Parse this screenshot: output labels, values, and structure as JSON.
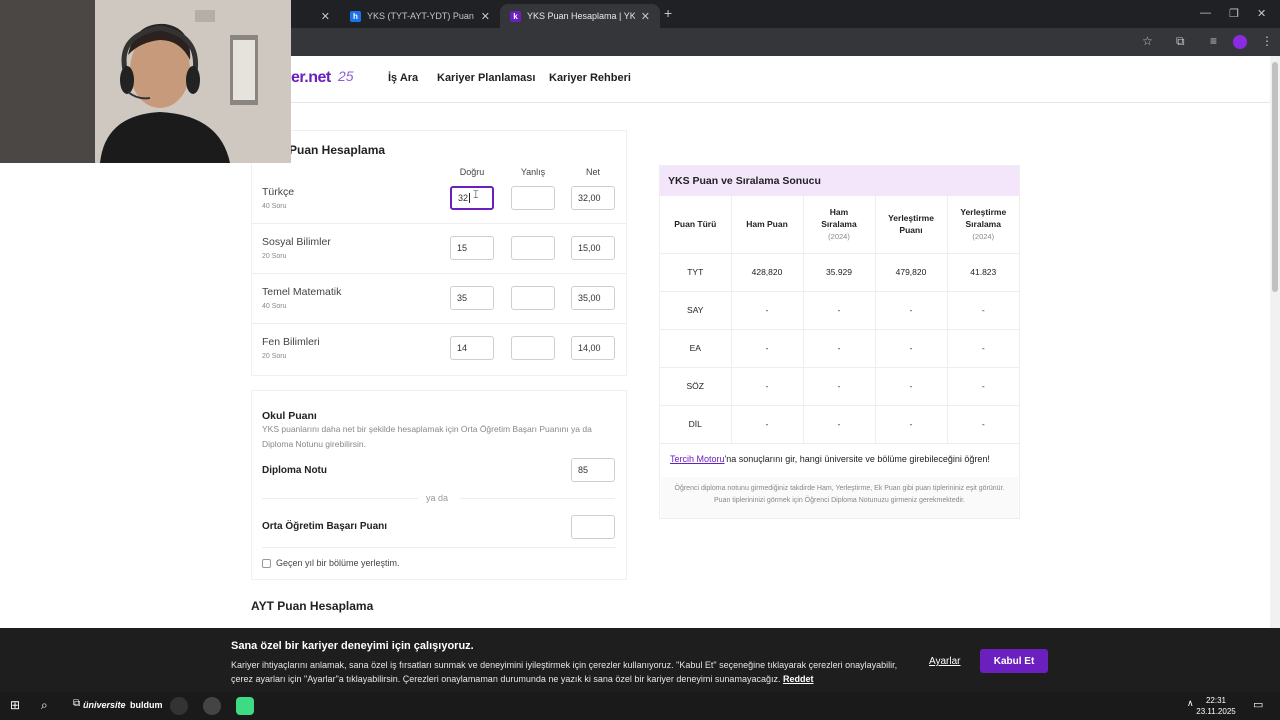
{
  "browser": {
    "tabs": [
      {
        "title": "",
        "active": false
      },
      {
        "title": "YKS (TYT-AYT-YDT) Puan Hesap",
        "active": false
      },
      {
        "title": "YKS Puan Hesaplama | YKS (TY",
        "active": true
      }
    ],
    "new_tab": "+"
  },
  "site": {
    "logo": "er.net",
    "logo_badge": "25",
    "nav": [
      "İş Ara",
      "Kariyer Planlaması",
      "Kariyer Rehberi"
    ]
  },
  "tyt": {
    "title": "Puan Hesaplama",
    "columns": {
      "dogru": "Doğru",
      "yanlis": "Yanlış",
      "net": "Net"
    },
    "rows": [
      {
        "subject": "Türkçe",
        "questions": "40 Soru",
        "dogru": "32",
        "yanlis": "",
        "net": "32,00"
      },
      {
        "subject": "Sosyal Bilimler",
        "questions": "20 Soru",
        "dogru": "15",
        "yanlis": "",
        "net": "15,00"
      },
      {
        "subject": "Temel Matematik",
        "questions": "40 Soru",
        "dogru": "35",
        "yanlis": "",
        "net": "35,00"
      },
      {
        "subject": "Fen Bilimleri",
        "questions": "20 Soru",
        "dogru": "14",
        "yanlis": "",
        "net": "14,00"
      }
    ]
  },
  "okul": {
    "title": "Okul Puanı",
    "desc": "YKS puanlarını daha net bir şekilde hesaplamak için Orta Öğretim Başarı Puanını ya da Diploma Notunu girebilirsin.",
    "diploma_label": "Diploma Notu",
    "diploma_value": "85",
    "or_label": "ya da",
    "obp_label": "Orta Öğretim Başarı Puanı",
    "obp_value": "",
    "checkbox_label": "Geçen yıl bir bölüme yerleştim."
  },
  "ayt": {
    "title": "AYT Puan Hesaplama"
  },
  "result": {
    "title": "YKS Puan ve Sıralama Sonucu",
    "headers": [
      {
        "label": "Puan Türü",
        "year": ""
      },
      {
        "label": "Ham Puan",
        "year": ""
      },
      {
        "label": "Ham Sıralama",
        "year": "(2024)"
      },
      {
        "label": "Yerleştirme Puanı",
        "year": ""
      },
      {
        "label": "Yerleştirme Sıralama",
        "year": "(2024)"
      }
    ],
    "rows": [
      [
        "TYT",
        "428,820",
        "35.929",
        "479,820",
        "41.823"
      ],
      [
        "SAY",
        "-",
        "-",
        "-",
        "-"
      ],
      [
        "EA",
        "-",
        "-",
        "-",
        "-"
      ],
      [
        "SÖZ",
        "-",
        "-",
        "-",
        "-"
      ],
      [
        "DİL",
        "-",
        "-",
        "-",
        "-"
      ]
    ],
    "note_link": "Tercih Motoru",
    "note_text": "'na sonuçlarını gir, hangi üniversite ve bölüme girebileceğini öğren!",
    "footnote": "Öğrenci diploma notunu girmediğiniz takdirde Ham, Yerleştirme, Ek Puan gibi puan tiplerininiz eşit görünür. Puan tiplerininizi görmek için Öğrenci Diploma Notunuzu girmeniz gerekmektedir."
  },
  "cookie": {
    "title": "Sana özel bir kariyer deneyimi için çalışıyoruz.",
    "text": "Kariyer ihtiyaçlarını anlamak, sana özel iş fırsatları sunmak ve deneyimini iyileştirmek için çerezler kullanıyoruz. \"Kabul Et\" seçeneğine tıklayarak çerezleri onaylayabilir, çerez ayarları için \"Ayarlar\"a tıklayabilirsin. Çerezleri onaylamaman durumunda ne yazık ki sana özel bir kariyer deneyimi sunamayacağız.",
    "reject": "Reddet",
    "settings": "Ayarlar",
    "accept": "Kabul Et"
  },
  "taskbar": {
    "time": "22:31",
    "date": "23.11.2025",
    "app_text_1": "üniversite",
    "app_text_2": "buldum"
  },
  "colors": {
    "brand": "#6b1fbf",
    "result_header": "#f3e6fa"
  }
}
